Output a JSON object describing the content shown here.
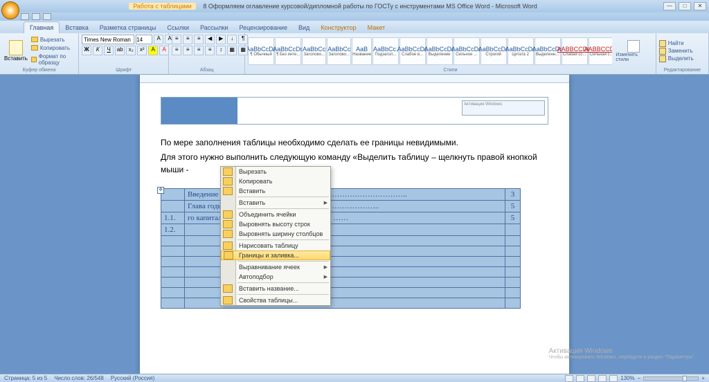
{
  "title": {
    "tools_context": "Работа с таблицами",
    "document": "8 Оформляем оглавление курсовой/дипломной работы по ГОСТу с инструментами MS Office Word - Microsoft Word"
  },
  "tabs": {
    "items": [
      "Главная",
      "Вставка",
      "Разметка страницы",
      "Ссылки",
      "Рассылки",
      "Рецензирование",
      "Вид",
      "Конструктор",
      "Макет"
    ]
  },
  "clipboard": {
    "paste": "Вставить",
    "cut": "Вырезать",
    "copy": "Копировать",
    "format": "Формат по образцу",
    "group": "Буфер обмена"
  },
  "font": {
    "name": "Times New Roman",
    "size": "14",
    "group": "Шрифт"
  },
  "paragraph": {
    "group": "Абзац"
  },
  "styles": {
    "group": "Стили",
    "items": [
      {
        "sample": "AaBbCcDc",
        "name": "¶ Обычный"
      },
      {
        "sample": "AaBbCcDc",
        "name": "¶ Без инте..."
      },
      {
        "sample": "AaBbCc",
        "name": "Заголово..."
      },
      {
        "sample": "AaBbCc",
        "name": "Заголово..."
      },
      {
        "sample": "АаВ",
        "name": "Название"
      },
      {
        "sample": "AaBbCc.",
        "name": "Подзагол..."
      },
      {
        "sample": "AaBbCcDc",
        "name": "Слабое в..."
      },
      {
        "sample": "AaBbCcDc",
        "name": "Выделение"
      },
      {
        "sample": "AaBbCcDc",
        "name": "Сильное ..."
      },
      {
        "sample": "AaBbCcDc",
        "name": "Строгий"
      },
      {
        "sample": "AaBbCcDc",
        "name": "Цитата 2"
      },
      {
        "sample": "AaBbCcDc",
        "name": "Выделенн..."
      },
      {
        "sample": "AABBCCDC",
        "name": "Слабая сс..."
      },
      {
        "sample": "AABBCCDC",
        "name": "Сильная с..."
      }
    ],
    "change": "Изменить стили"
  },
  "editing": {
    "find": "Найти",
    "replace": "Заменить",
    "select": "Выделить",
    "group": "Редактирование"
  },
  "document": {
    "para1": "По мере заполнения таблицы необходимо сделать ее границы невидимыми.",
    "para2": "Для этого нужно выполнить следующую команду «Выделить таблицу – щелкнуть правой кнопкой мыши -",
    "toc": [
      {
        "num": "",
        "title": "Введение",
        "dots": "………………………………………………………………..",
        "pg": "3"
      },
      {
        "num": "",
        "title": "Глава",
        "dots": "годы анализа оборотного капитала …………………..",
        "pg": "5"
      },
      {
        "num": "1.1.",
        "title": "",
        "dots": "го капитала и его роль в жизни предприятия ……",
        "pg": "5"
      },
      {
        "num": "1.2.",
        "title": "",
        "dots": "",
        "pg": ""
      },
      {
        "num": "",
        "title": "",
        "dots": "",
        "pg": ""
      },
      {
        "num": "",
        "title": "",
        "dots": "",
        "pg": ""
      },
      {
        "num": "",
        "title": "",
        "dots": "",
        "pg": ""
      },
      {
        "num": "",
        "title": "",
        "dots": "",
        "pg": ""
      },
      {
        "num": "",
        "title": "",
        "dots": "",
        "pg": ""
      },
      {
        "num": "",
        "title": "",
        "dots": "",
        "pg": ""
      },
      {
        "num": "",
        "title": "",
        "dots": "",
        "pg": ""
      }
    ]
  },
  "context_menu": {
    "cut": "Вырезать",
    "copy": "Копировать",
    "paste": "Вставить",
    "insert": "Вставить",
    "merge": "Объединить ячейки",
    "row_height": "Выровнять высоту строк",
    "col_width": "Выровнять ширину столбцов",
    "draw": "Нарисовать таблицу",
    "borders": "Границы и заливка...",
    "align": "Выравнивание ячеек",
    "autofit": "Автоподбор",
    "caption": "Вставить название...",
    "props": "Свойства таблицы..."
  },
  "watermark": {
    "title": "Активация Windows",
    "sub": "Чтобы активировать Windows, перейдите в раздел \"Параметры\"."
  },
  "status": {
    "page": "Страница: 5 из 5",
    "words": "Число слов: 26/548",
    "lang": "Русский (Россия)",
    "zoom": "130%"
  }
}
